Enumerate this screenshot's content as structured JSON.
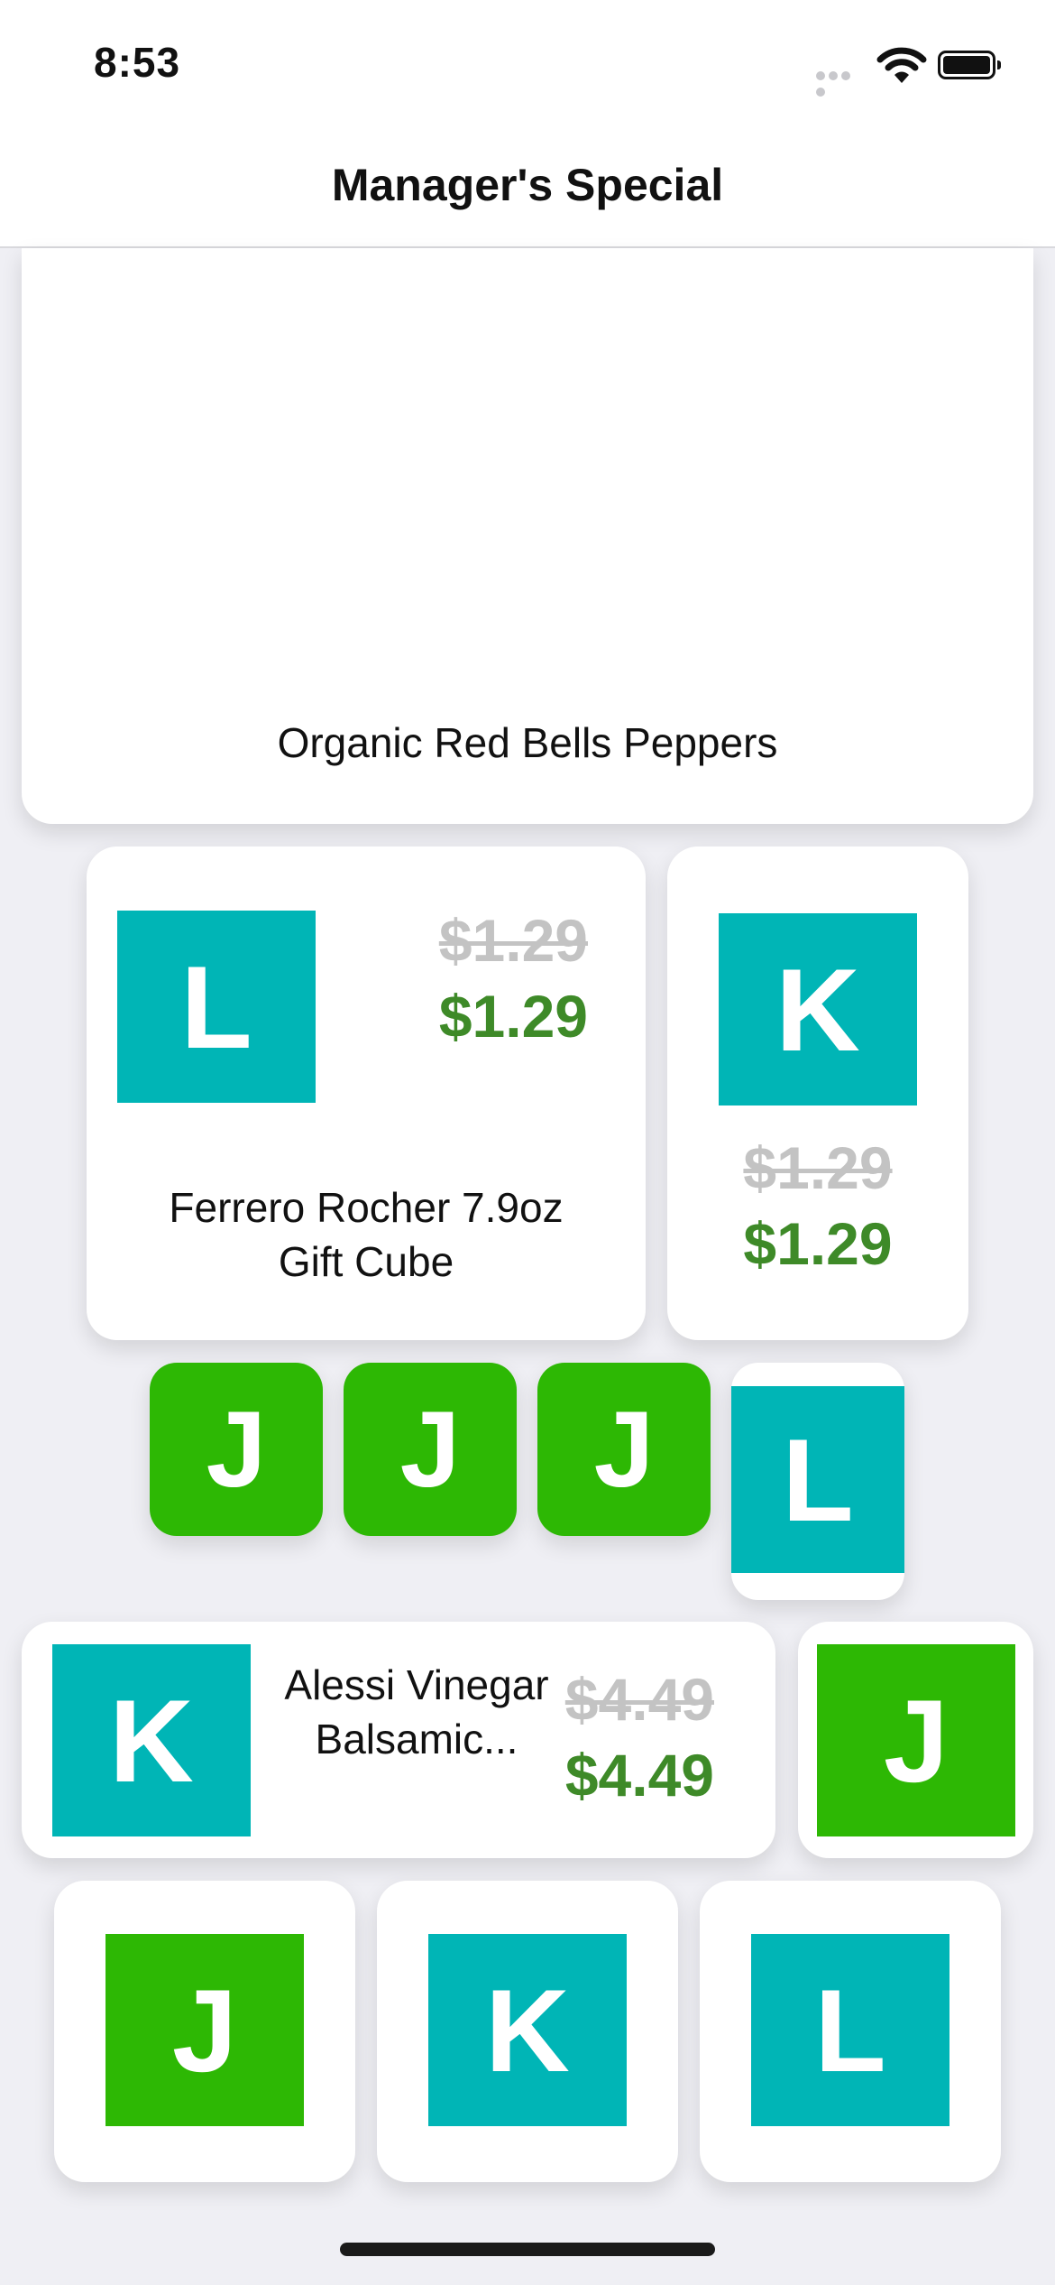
{
  "status_bar": {
    "time": "8:53"
  },
  "navbar": {
    "title": "Manager's Special"
  },
  "specials": [
    {
      "name": "Organic Red Bells Peppers"
    },
    {
      "tile": "L",
      "old_price": "$1.29",
      "new_price": "$1.29",
      "name": "Ferrero Rocher 7.9oz Gift Cube",
      "color": "#00b5b6"
    },
    {
      "tile": "K",
      "old_price": "$1.29",
      "new_price": "$1.29",
      "color": "#00b5b6"
    },
    {
      "tile": "J",
      "color": "#2db804"
    },
    {
      "tile": "J",
      "color": "#2db804"
    },
    {
      "tile": "J",
      "color": "#2db804"
    },
    {
      "tile": "L",
      "color": "#00b5b6"
    },
    {
      "tile": "K",
      "name": "Alessi Vinegar Balsamic...",
      "old_price": "$4.49",
      "new_price": "$4.49",
      "color": "#00b5b6"
    },
    {
      "tile": "J",
      "color": "#2db804"
    },
    {
      "tile": "J",
      "color": "#2db804"
    },
    {
      "tile": "K",
      "color": "#00b5b6"
    },
    {
      "tile": "L",
      "color": "#00b5b6"
    }
  ]
}
